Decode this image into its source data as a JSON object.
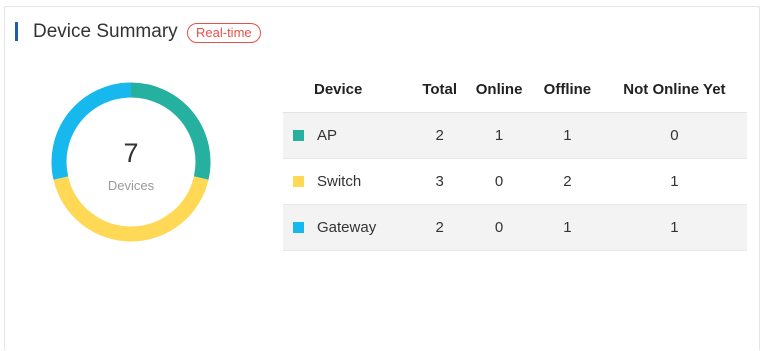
{
  "header": {
    "title": "Device Summary",
    "badge": "Real-time"
  },
  "donut": {
    "total": "7",
    "label": "Devices",
    "segments": [
      {
        "name": "AP",
        "value": 2,
        "color": "#26b0a0"
      },
      {
        "name": "Switch",
        "value": 3,
        "color": "#ffd855"
      },
      {
        "name": "Gateway",
        "value": 2,
        "color": "#16b8ee"
      }
    ]
  },
  "table": {
    "columns": [
      "Device",
      "Total",
      "Online",
      "Offline",
      "Not Online Yet"
    ],
    "rows": [
      {
        "device": "AP",
        "color": "#26b0a0",
        "total": "2",
        "online": "1",
        "offline": "1",
        "not_online_yet": "0"
      },
      {
        "device": "Switch",
        "color": "#ffd855",
        "total": "3",
        "online": "0",
        "offline": "2",
        "not_online_yet": "1"
      },
      {
        "device": "Gateway",
        "color": "#16b8ee",
        "total": "2",
        "online": "0",
        "offline": "1",
        "not_online_yet": "1"
      }
    ]
  }
}
